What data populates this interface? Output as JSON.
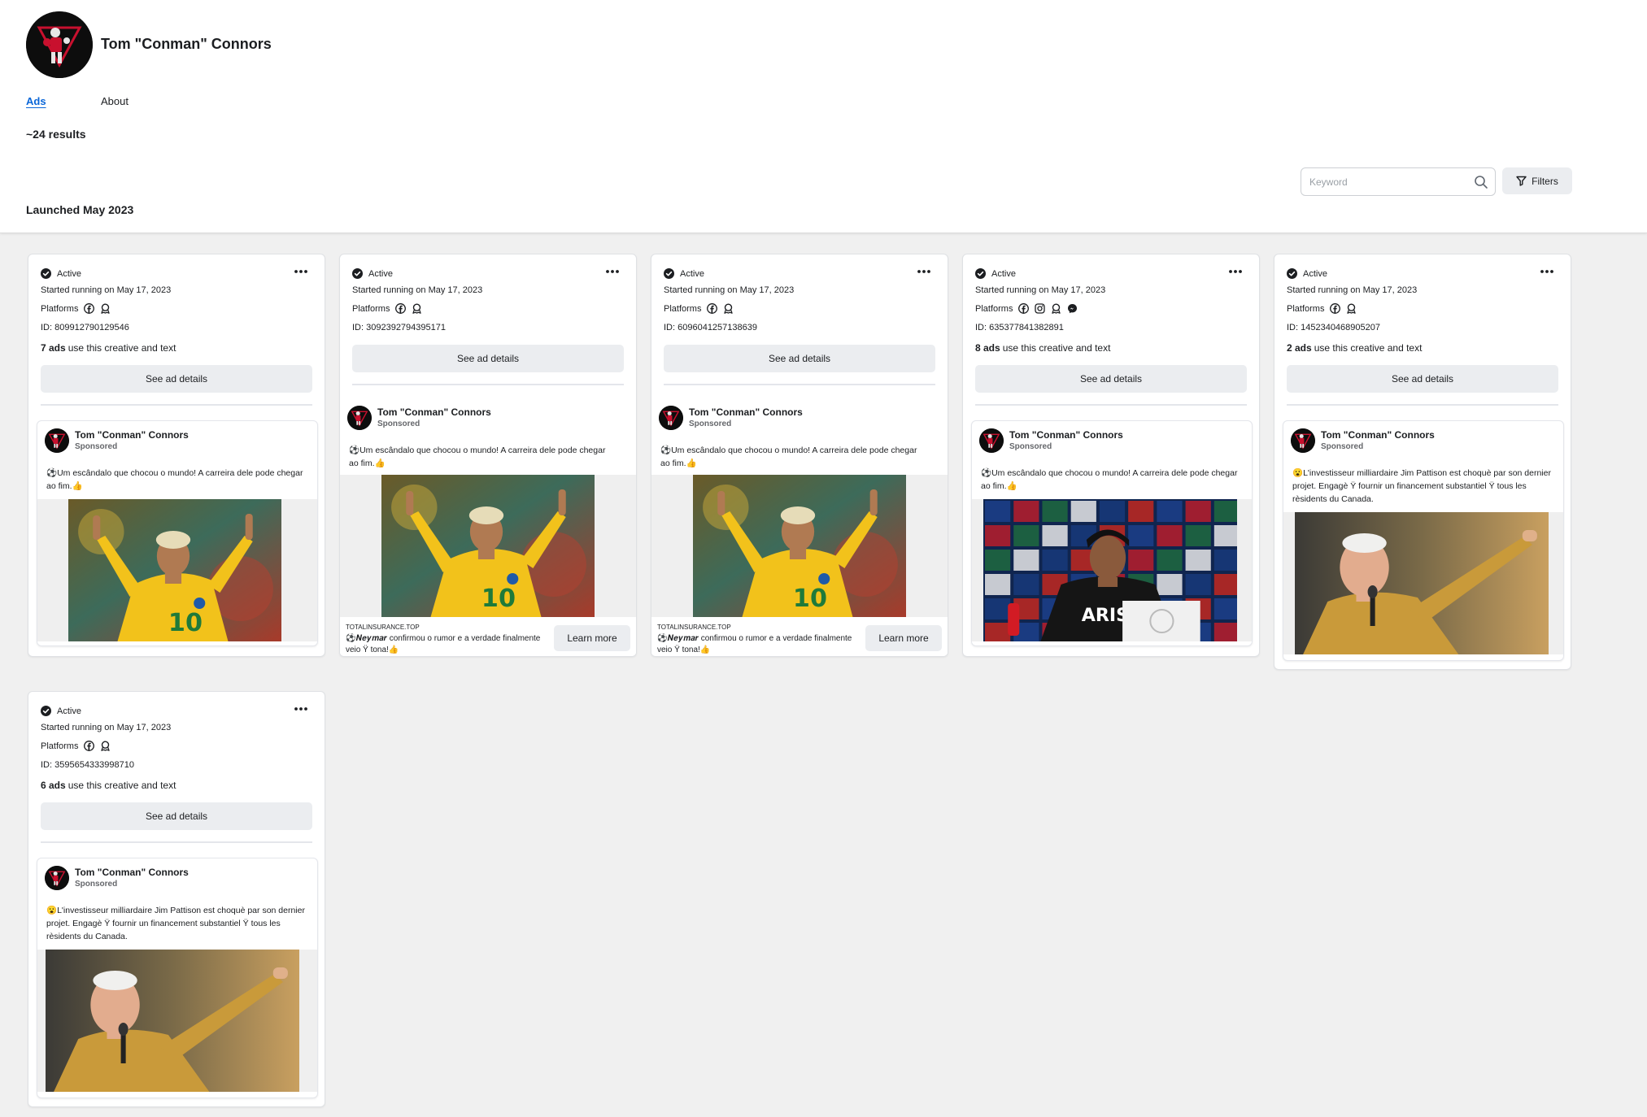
{
  "page": {
    "name": "Tom \"Conman\" Connors",
    "tabs": [
      {
        "label": "Ads"
      },
      {
        "label": "About"
      }
    ],
    "results": "~24 results",
    "section_title": "Launched May 2023",
    "search_placeholder": "Keyword",
    "filters_label": "Filters"
  },
  "common": {
    "active": "Active",
    "started": "Started running on May 17, 2023",
    "platforms": "Platforms",
    "see_details": "See ad details",
    "sponsored": "Sponsored",
    "uses_text": "use this creative and text",
    "learn_more": "Learn more"
  },
  "colors": {
    "accent": "#0a66d8",
    "button_bg": "#ebedf0",
    "page_bg": "#f0f0f0"
  },
  "cards": [
    {
      "id": "ID: 809912790129546",
      "ads_count": "7 ads",
      "advertiser": "Tom \"Conman\" Connors",
      "text": "⚽️Um escândalo que chocou o mundo! A carreira dele pode chegar ao fim.👍",
      "image": "footballer-celebrating-photo",
      "platforms": [
        "facebook-icon",
        "audience-network-icon"
      ]
    },
    {
      "id": "ID: 3092392794395171",
      "ads_count": "",
      "advertiser": "Tom \"Conman\" Connors",
      "text": "⚽️Um escândalo que chocou o mundo! A carreira dele pode chegar ao fim.👍",
      "image": "footballer-celebrating-photo",
      "platforms": [
        "facebook-icon",
        "audience-network-icon"
      ],
      "link": {
        "domain": "TOTALINSURANCE.TOP",
        "headline": "⚽️𝑵𝒆𝒚𝒎𝒂𝒓 confirmou o rumor e a verdade finalmente veio Ÿ tona!👍"
      }
    },
    {
      "id": "ID: 6096041257138639",
      "ads_count": "",
      "advertiser": "Tom \"Conman\" Connors",
      "text": "⚽️Um escândalo que chocou o mundo! A carreira dele pode chegar ao fim.👍",
      "image": "footballer-celebrating-photo",
      "platforms": [
        "facebook-icon",
        "audience-network-icon"
      ],
      "link": {
        "domain": "TOTALINSURANCE.TOP",
        "headline": "⚽️𝑵𝒆𝒚𝒎𝒂𝒓 confirmou o rumor e a verdade finalmente veio Ÿ tona!👍"
      }
    },
    {
      "id": "ID: 635377841382891",
      "ads_count": "8 ads",
      "advertiser": "Tom \"Conman\" Connors",
      "text": "⚽️Um escândalo que chocou o mundo! A carreira dele pode chegar ao fim.👍",
      "image": "press-conference-photo",
      "platforms": [
        "facebook-icon",
        "instagram-icon",
        "audience-network-icon",
        "messenger-icon"
      ]
    },
    {
      "id": "ID: 1452340468905207",
      "ads_count": "2 ads",
      "advertiser": "Tom \"Conman\" Connors",
      "text": "😮L'investisseur milliardaire Jim Pattison est choquè par son dernier projet. Engagè Ÿ fournir un financement substantiel Ÿ tous les rèsidents du Canada.",
      "image": "businessman-speaking-photo",
      "platforms": [
        "facebook-icon",
        "audience-network-icon"
      ]
    },
    {
      "id": "ID: 3595654333998710",
      "ads_count": "6 ads",
      "advertiser": "Tom \"Conman\" Connors",
      "text": "😮L'investisseur milliardaire Jim Pattison est choquè par son dernier projet. Engagè Ÿ fournir un financement substantiel Ÿ tous les rèsidents du Canada.",
      "image": "businessman-speaking-photo",
      "platforms": [
        "facebook-icon",
        "audience-network-icon"
      ]
    }
  ]
}
